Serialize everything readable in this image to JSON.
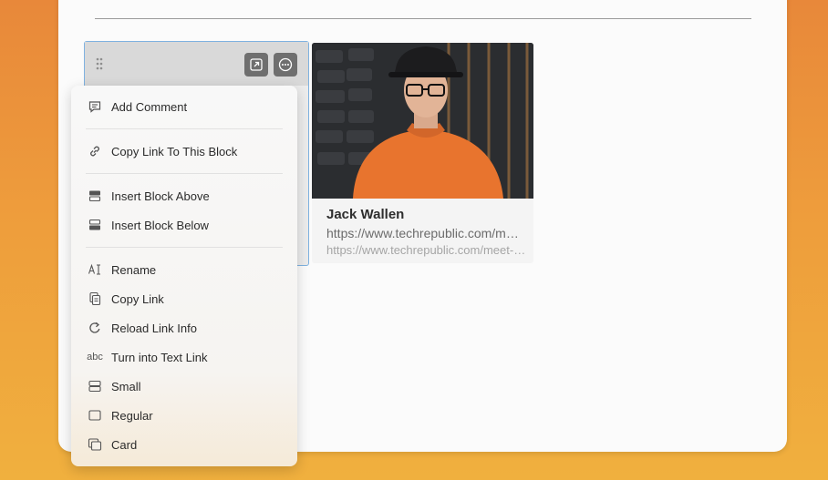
{
  "menu": {
    "items": [
      {
        "label": "Add Comment",
        "icon": "comment-icon"
      },
      {
        "label": "Copy Link To This Block",
        "icon": "link-icon"
      },
      {
        "label": "Insert Block Above",
        "icon": "insert-above-icon"
      },
      {
        "label": "Insert Block Below",
        "icon": "insert-below-icon"
      },
      {
        "label": "Rename",
        "icon": "rename-icon"
      },
      {
        "label": "Copy Link",
        "icon": "copy-icon"
      },
      {
        "label": "Reload Link Info",
        "icon": "reload-icon"
      },
      {
        "label": "Turn into Text Link",
        "icon": "text-link-icon",
        "glyph": "abc"
      },
      {
        "label": "Small",
        "icon": "small-view-icon"
      },
      {
        "label": "Regular",
        "icon": "regular-view-icon"
      },
      {
        "label": "Card",
        "icon": "card-view-icon"
      }
    ]
  },
  "link_card": {
    "title": "Jack Wallen",
    "description": "https://www.techrepublic.com/meet-the-team/us/jack-wallen/",
    "url": "https://www.techrepublic.com/meet-the-team/us/jack-wallen/"
  },
  "colors": {
    "background_top": "#e8883a",
    "background_bottom": "#f0b03e",
    "selection_border": "#7fb2e0"
  }
}
